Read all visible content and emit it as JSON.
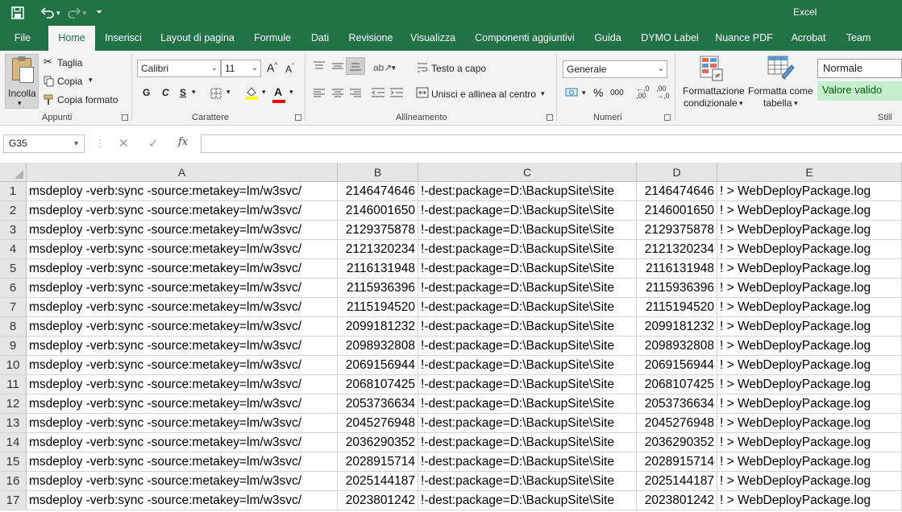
{
  "title_bar": {
    "app_title": "Excel",
    "qat": {
      "save_icon": "save-icon",
      "undo_icon": "undo-icon",
      "redo_icon": "redo-icon",
      "customize_icon": "customize-qat-icon"
    }
  },
  "ribbon_tabs": [
    "File",
    "Home",
    "Inserisci",
    "Layout di pagina",
    "Formule",
    "Dati",
    "Revisione",
    "Visualizza",
    "Componenti aggiuntivi",
    "Guida",
    "DYMO Label",
    "Nuance PDF",
    "Acrobat",
    "Team"
  ],
  "active_tab": "Home",
  "ribbon": {
    "appunti": {
      "label": "Appunti",
      "paste": "Incolla",
      "cut": "Taglia",
      "copy": "Copia",
      "format_painter": "Copia formato"
    },
    "carattere": {
      "label": "Carattere",
      "font_name": "Calibri",
      "font_size": "11",
      "grow": "A",
      "shrink": "A",
      "bold": "G",
      "italic": "C",
      "underline": "S",
      "font_color_letter": "A",
      "fill_color": "#ffff00",
      "font_color": "#ff0000"
    },
    "allineamento": {
      "label": "Allineamento",
      "wrap_text": "Testo a capo",
      "merge_center": "Unisci e allinea al centro"
    },
    "numeri": {
      "label": "Numeri",
      "format": "Generale",
      "percent": "%",
      "thousands": "000"
    },
    "stili": {
      "label": "Stili",
      "conditional_line1": "Formattazione",
      "conditional_line2": "condizionale",
      "table_line1": "Formatta come",
      "table_line2": "tabella",
      "style_normal": "Normale",
      "style_good": "Valore valido",
      "good_bg": "#c6efce",
      "good_fg": "#006100"
    }
  },
  "formula_bar": {
    "name_box": "G35",
    "fx_label": "fx",
    "cancel": "✕",
    "enter": "✓",
    "value": ""
  },
  "sheet": {
    "columns": [
      "A",
      "B",
      "C",
      "D",
      "E"
    ],
    "rows": [
      {
        "n": "1",
        "a": "msdeploy -verb:sync -source:metakey=lm/w3svc/",
        "b": "2146474646",
        "c": "!-dest:package=D:\\BackupSite\\Site",
        "d": "2146474646",
        "e": "! > WebDeployPackage.log"
      },
      {
        "n": "2",
        "a": "msdeploy -verb:sync -source:metakey=lm/w3svc/",
        "b": "2146001650",
        "c": "!-dest:package=D:\\BackupSite\\Site",
        "d": "2146001650",
        "e": "! > WebDeployPackage.log"
      },
      {
        "n": "3",
        "a": "msdeploy -verb:sync -source:metakey=lm/w3svc/",
        "b": "2129375878",
        "c": "!-dest:package=D:\\BackupSite\\Site",
        "d": "2129375878",
        "e": "! > WebDeployPackage.log"
      },
      {
        "n": "4",
        "a": "msdeploy -verb:sync -source:metakey=lm/w3svc/",
        "b": "2121320234",
        "c": "!-dest:package=D:\\BackupSite\\Site",
        "d": "2121320234",
        "e": "! > WebDeployPackage.log"
      },
      {
        "n": "5",
        "a": "msdeploy -verb:sync -source:metakey=lm/w3svc/",
        "b": "2116131948",
        "c": "!-dest:package=D:\\BackupSite\\Site",
        "d": "2116131948",
        "e": "! > WebDeployPackage.log"
      },
      {
        "n": "6",
        "a": "msdeploy -verb:sync -source:metakey=lm/w3svc/",
        "b": "2115936396",
        "c": "!-dest:package=D:\\BackupSite\\Site",
        "d": "2115936396",
        "e": "! > WebDeployPackage.log"
      },
      {
        "n": "7",
        "a": "msdeploy -verb:sync -source:metakey=lm/w3svc/",
        "b": "2115194520",
        "c": "!-dest:package=D:\\BackupSite\\Site",
        "d": "2115194520",
        "e": "! > WebDeployPackage.log"
      },
      {
        "n": "8",
        "a": "msdeploy -verb:sync -source:metakey=lm/w3svc/",
        "b": "2099181232",
        "c": "!-dest:package=D:\\BackupSite\\Site",
        "d": "2099181232",
        "e": "! > WebDeployPackage.log"
      },
      {
        "n": "9",
        "a": "msdeploy -verb:sync -source:metakey=lm/w3svc/",
        "b": "2098932808",
        "c": "!-dest:package=D:\\BackupSite\\Site",
        "d": "2098932808",
        "e": "! > WebDeployPackage.log"
      },
      {
        "n": "10",
        "a": "msdeploy -verb:sync -source:metakey=lm/w3svc/",
        "b": "2069156944",
        "c": "!-dest:package=D:\\BackupSite\\Site",
        "d": "2069156944",
        "e": "! > WebDeployPackage.log"
      },
      {
        "n": "11",
        "a": "msdeploy -verb:sync -source:metakey=lm/w3svc/",
        "b": "2068107425",
        "c": "!-dest:package=D:\\BackupSite\\Site",
        "d": "2068107425",
        "e": "! > WebDeployPackage.log"
      },
      {
        "n": "12",
        "a": "msdeploy -verb:sync -source:metakey=lm/w3svc/",
        "b": "2053736634",
        "c": "!-dest:package=D:\\BackupSite\\Site",
        "d": "2053736634",
        "e": "! > WebDeployPackage.log"
      },
      {
        "n": "13",
        "a": "msdeploy -verb:sync -source:metakey=lm/w3svc/",
        "b": "2045276948",
        "c": "!-dest:package=D:\\BackupSite\\Site",
        "d": "2045276948",
        "e": "! > WebDeployPackage.log"
      },
      {
        "n": "14",
        "a": "msdeploy -verb:sync -source:metakey=lm/w3svc/",
        "b": "2036290352",
        "c": "!-dest:package=D:\\BackupSite\\Site",
        "d": "2036290352",
        "e": "! > WebDeployPackage.log"
      },
      {
        "n": "15",
        "a": "msdeploy -verb:sync -source:metakey=lm/w3svc/",
        "b": "2028915714",
        "c": "!-dest:package=D:\\BackupSite\\Site",
        "d": "2028915714",
        "e": "! > WebDeployPackage.log"
      },
      {
        "n": "16",
        "a": "msdeploy -verb:sync -source:metakey=lm/w3svc/",
        "b": "2025144187",
        "c": "!-dest:package=D:\\BackupSite\\Site",
        "d": "2025144187",
        "e": "! > WebDeployPackage.log"
      },
      {
        "n": "17",
        "a": "msdeploy -verb:sync -source:metakey=lm/w3svc/",
        "b": "2023801242",
        "c": "!-dest:package=D:\\BackupSite\\Site",
        "d": "2023801242",
        "e": "! > WebDeployPackage.log"
      }
    ]
  }
}
